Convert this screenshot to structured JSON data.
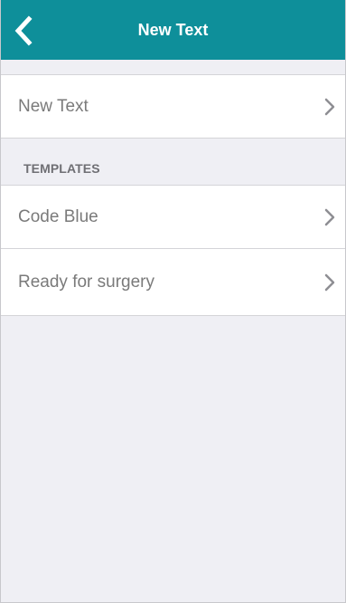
{
  "navbar": {
    "title": "New Text",
    "back_icon": "chevron-left-icon",
    "background_color": "#0e8f9a"
  },
  "main": {
    "new_text_row": {
      "label": "New Text",
      "chevron_icon": "chevron-right-icon"
    },
    "templates_section": {
      "header": "TEMPLATES",
      "items": [
        {
          "label": "Code Blue",
          "chevron_icon": "chevron-right-icon"
        },
        {
          "label": "Ready for surgery",
          "chevron_icon": "chevron-right-icon"
        }
      ]
    }
  }
}
